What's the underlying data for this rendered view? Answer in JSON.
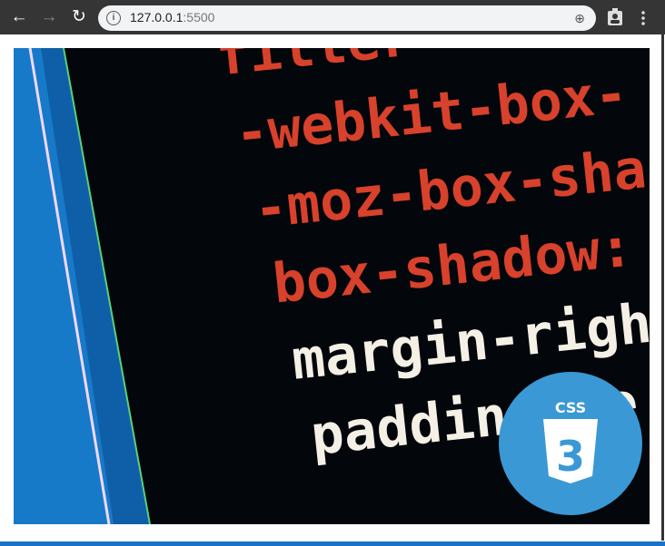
{
  "browser": {
    "url_host": "127.0.0.1",
    "url_port": ":5500",
    "icons": [
      "back-arrow-icon",
      "forward-arrow-icon",
      "reload-icon",
      "info-icon",
      "zoom-icon",
      "profile-icon",
      "menu-dots-icon"
    ]
  },
  "page": {
    "image": {
      "code_lines_red": [
        "filter",
        "-webkit-box-",
        "-moz-box-sha",
        "box-shadow:"
      ],
      "code_lines_white": [
        "margin-righ",
        "padding-le"
      ],
      "logo_text": "CSS",
      "logo_number": "3",
      "logo_color": "#3a98d5"
    }
  }
}
